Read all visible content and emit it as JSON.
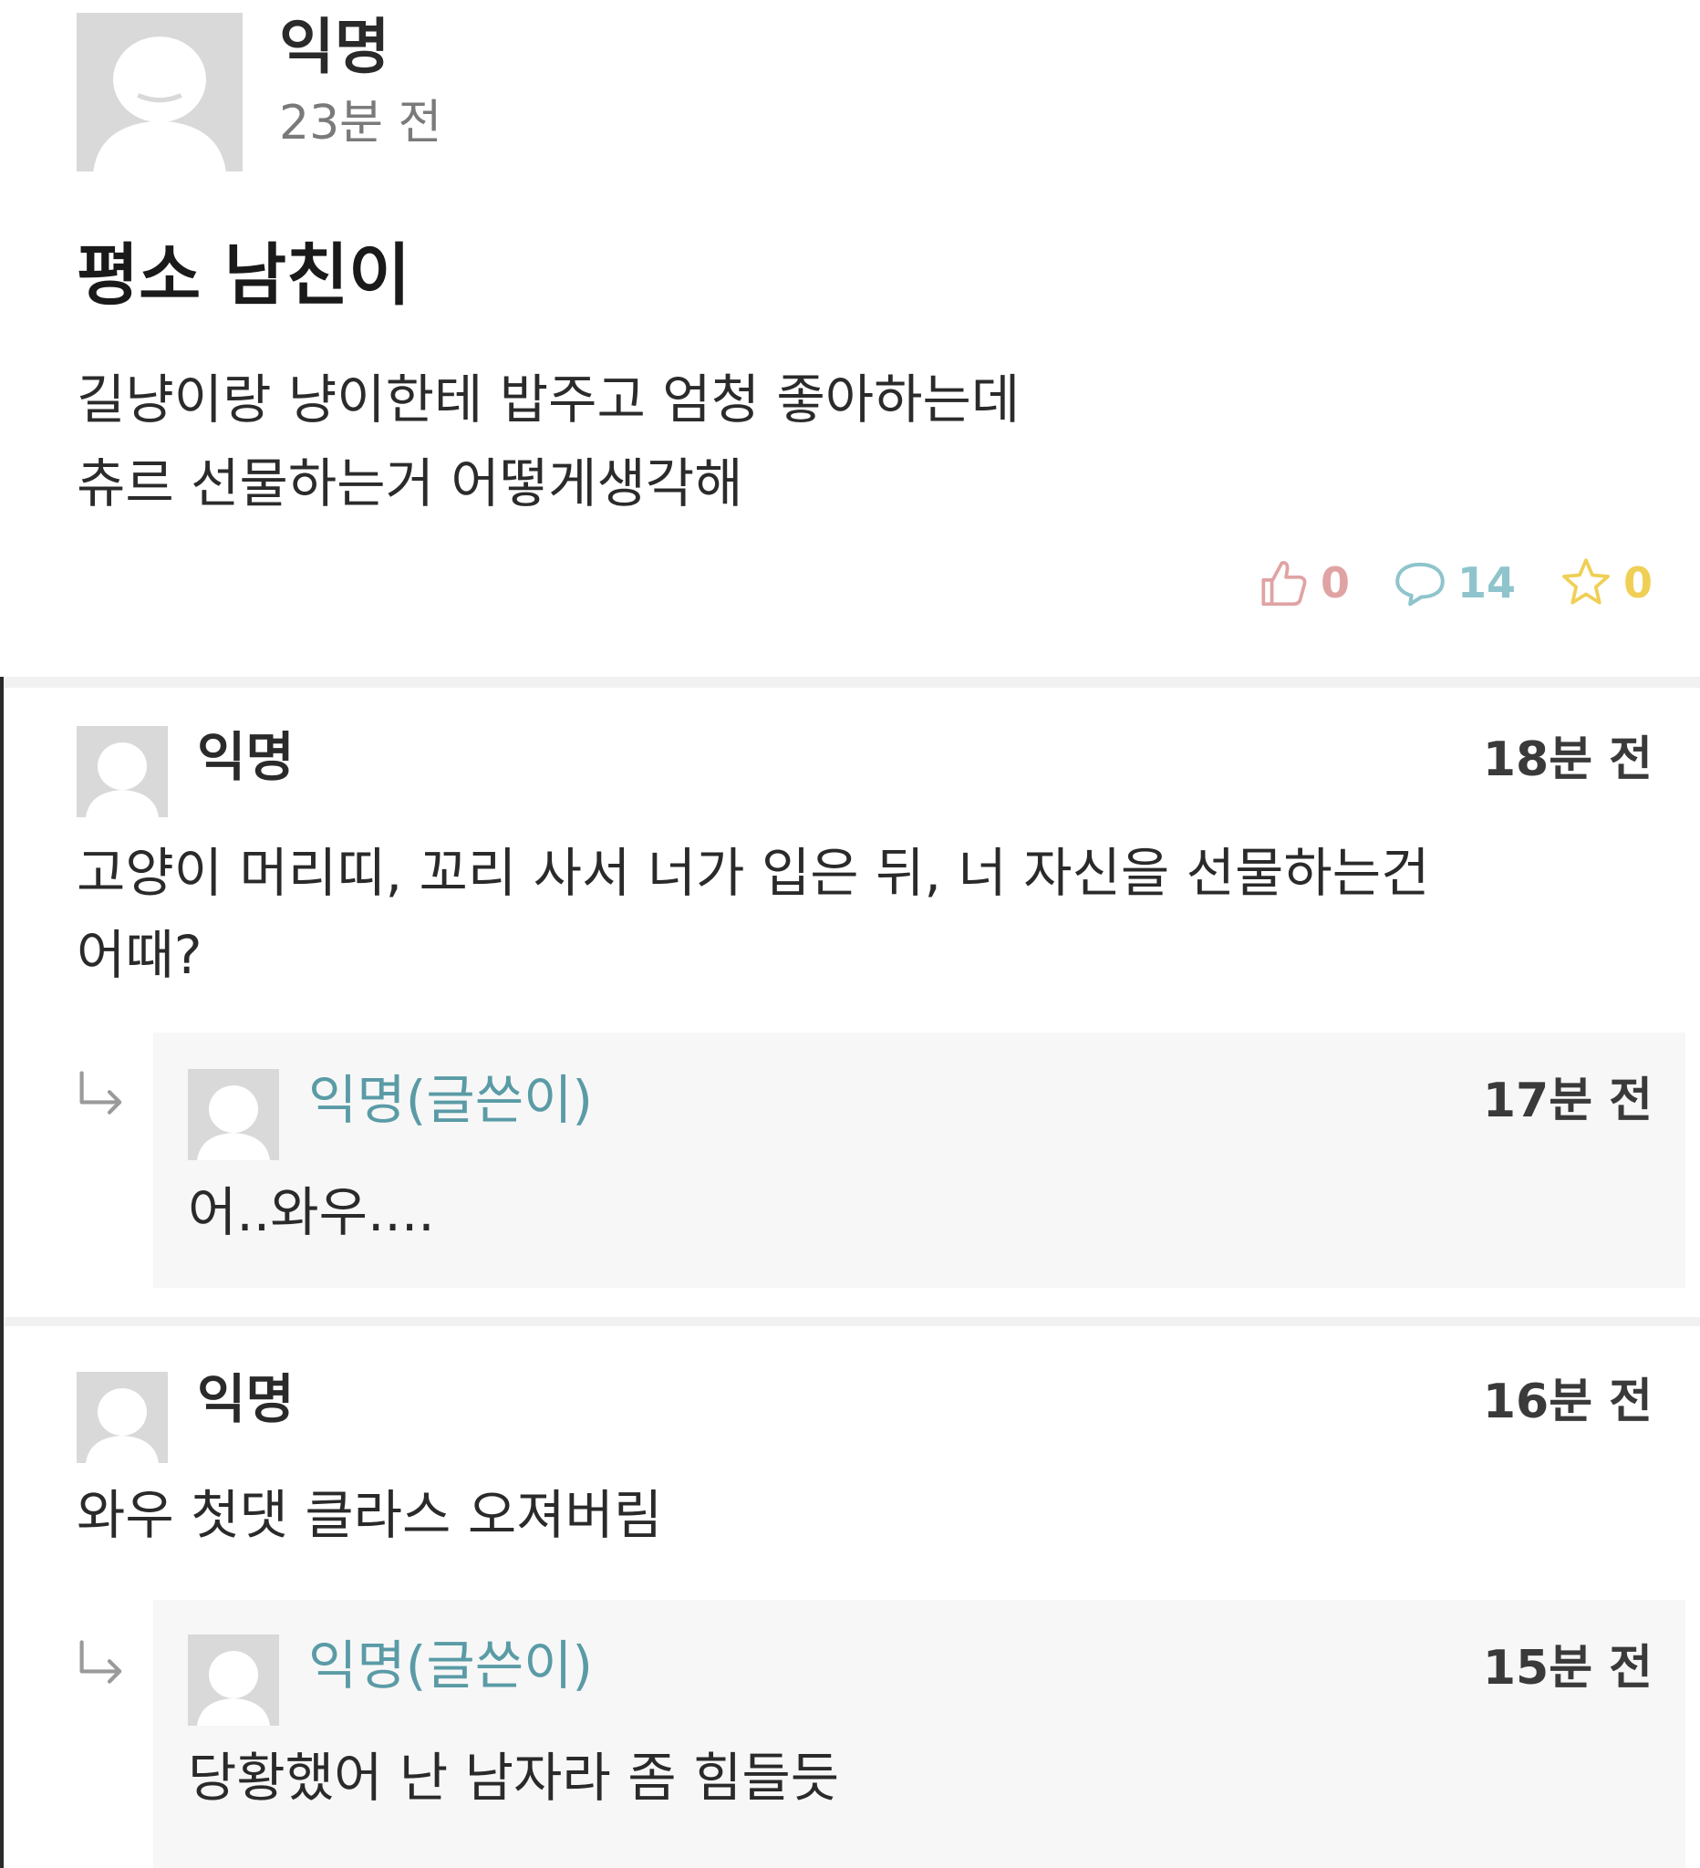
{
  "post": {
    "author": "익명",
    "time": "23분 전",
    "title": "평소 남친이",
    "body_lines": [
      "길냥이랑 냥이한테 밥주고 엄청 좋아하는데",
      "츄르 선물하는거 어떻게생각해"
    ],
    "stats": {
      "likes": "0",
      "comments": "14",
      "scraps": "0"
    }
  },
  "comments": [
    {
      "author": "익명",
      "time": "18분 전",
      "text_lines": [
        "고양이 머리띠, 꼬리 사서 너가 입은 뒤, 너 자신을 선물하는건",
        "어때?"
      ],
      "reply": {
        "author": "익명(글쓴이)",
        "time": "17분 전",
        "text": "어..와우...."
      }
    },
    {
      "author": "익명",
      "time": "16분 전",
      "text_lines": [
        "와우 첫댓 클라스 오져버림"
      ],
      "reply": {
        "author": "익명(글쓴이)",
        "time": "15분 전",
        "text": "당황했어 난 남자라 좀 힘들듯"
      }
    }
  ],
  "colors": {
    "writer_name": "#5a9ba6",
    "like": "#e0a3a3",
    "comment": "#8fc4cc",
    "scrap": "#f0cf55"
  },
  "icons": {
    "avatar": "default-profile-icon",
    "like": "thumbs-up-icon",
    "comment": "speech-bubble-icon",
    "scrap": "star-icon",
    "reply": "reply-arrow-icon"
  }
}
